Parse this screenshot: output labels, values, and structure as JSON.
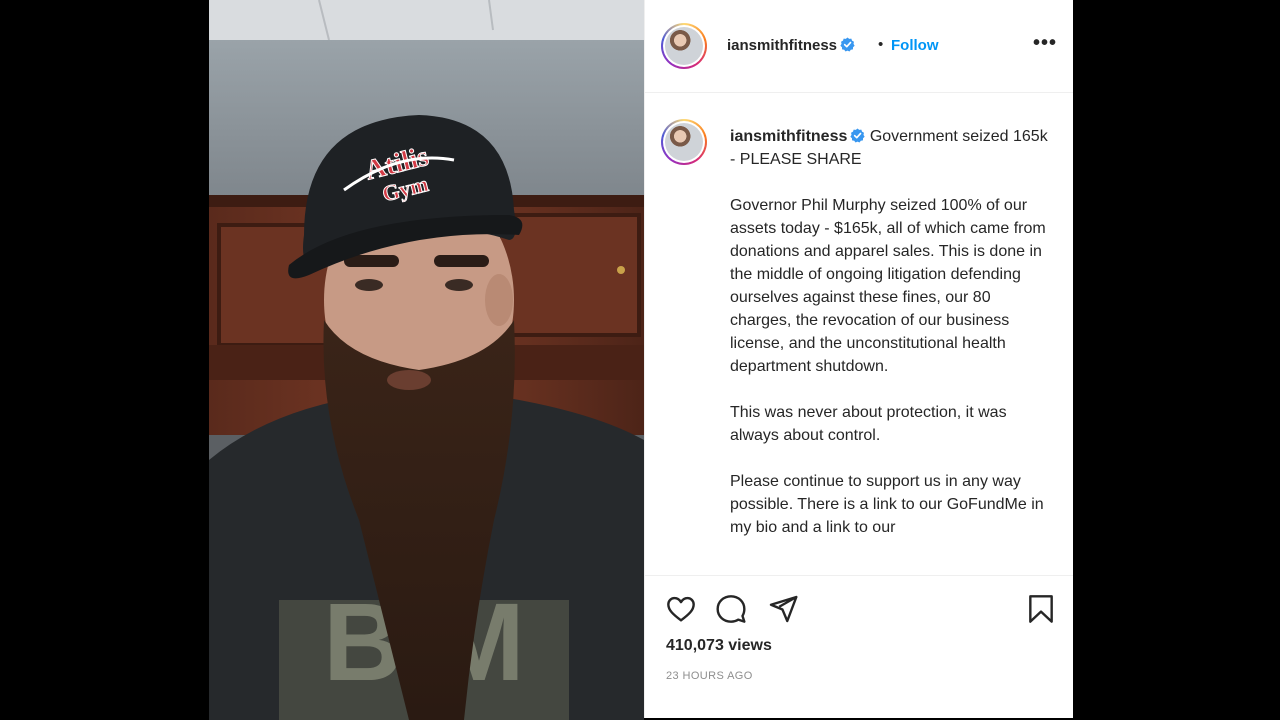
{
  "post": {
    "username": "iansmithfitness",
    "verified": true,
    "separator": "•",
    "follow_label": "Follow",
    "more_label": "•••",
    "caption_lead": "Government seized 165k - PLEASE SHARE",
    "caption_body": "Governor Phil Murphy seized 100% of our assets today - $165k, all of which came from donations and apparel sales. This is done in the middle of ongoing litigation defending ourselves against these fines, our 80 charges, the revocation of our business license, and the unconstitutional health department shutdown.\n\nThis was never about protection, it was always about control.\n\nPlease continue to support us in any way possible. There is a link to our GoFundMe in my bio and a link to our",
    "views": "410,073 views",
    "timestamp": "23 HOURS AGO"
  },
  "media": {
    "hat_text_line1": "Atilis",
    "hat_text_line2": "Gym"
  },
  "icons": {
    "like": "heart-icon",
    "comment": "comment-icon",
    "share": "send-icon",
    "save": "bookmark-icon",
    "verified": "verified-badge-icon"
  },
  "colors": {
    "follow": "#0095f6",
    "verified": "#3897f0",
    "muted": "#8e8e8e"
  }
}
